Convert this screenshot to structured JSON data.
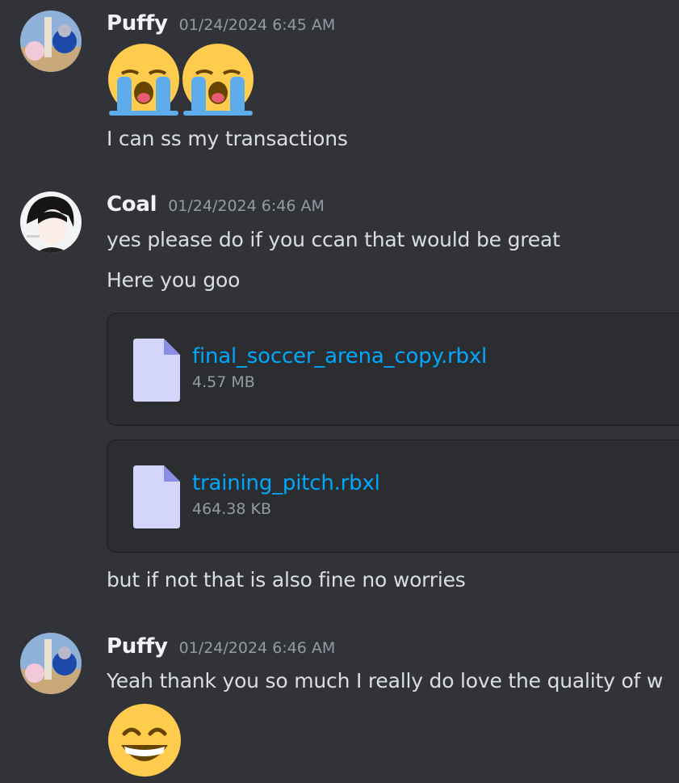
{
  "messages": [
    {
      "username": "Puffy",
      "timestamp": "01/24/2024 6:45 AM",
      "emojis": [
        "loudly-crying-face",
        "loudly-crying-face"
      ],
      "lines": [
        "I can ss my transactions"
      ]
    },
    {
      "username": "Coal",
      "timestamp": "01/24/2024 6:46 AM",
      "lines": [
        "yes please do if you ccan that would be great",
        "Here you goo"
      ],
      "attachments": [
        {
          "name": "final_soccer_arena_copy.rbxl",
          "size": "4.57 MB"
        },
        {
          "name": "training_pitch.rbxl",
          "size": "464.38 KB"
        }
      ],
      "after_line": "but if not that is also fine no worries"
    },
    {
      "username": "Puffy",
      "timestamp": "01/24/2024 6:46 AM",
      "lines": [
        "Yeah thank you so much I really do love the quality of w"
      ],
      "emojis": [
        "grinning-face-with-smiling-eyes"
      ]
    }
  ],
  "colors": {
    "background": "#313338",
    "attachment_bg": "#2b2d31",
    "link": "#00a8fc",
    "muted": "#949ba4",
    "file_icon": "#d4d5fa"
  }
}
